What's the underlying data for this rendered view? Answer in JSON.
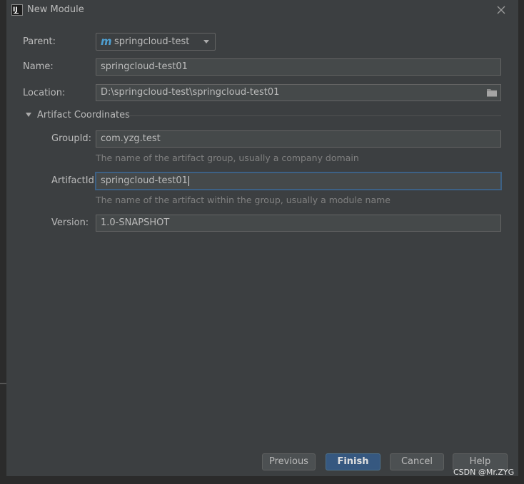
{
  "dialog": {
    "title": "New Module",
    "close_icon": "close-icon",
    "app_icon_text": "IJ"
  },
  "form": {
    "parent_label": "Parent:",
    "parent_value": "springcloud-test",
    "parent_icon": "maven-icon",
    "name_label": "Name:",
    "name_value": "springcloud-test01",
    "location_label": "Location:",
    "location_value": "D:\\springcloud-test\\springcloud-test01",
    "location_icon": "folder-icon"
  },
  "artifact": {
    "section_title": "Artifact Coordinates",
    "groupid_label": "GroupId:",
    "groupid_value": "com.yzg.test",
    "groupid_hint": "The name of the artifact group, usually a company domain",
    "artifactid_label": "ArtifactId:",
    "artifactid_value": "springcloud-test01",
    "artifactid_hint": "The name of the artifact within the group, usually a module name",
    "version_label": "Version:",
    "version_value": "1.0-SNAPSHOT"
  },
  "buttons": {
    "previous": "Previous",
    "finish": "Finish",
    "cancel": "Cancel",
    "help": "Help"
  },
  "watermark": "CSDN @Mr.ZYG",
  "colors": {
    "dialog_bg": "#3c3f41",
    "field_bg": "#45494a",
    "focus_border": "#3d6185",
    "primary_button": "#365880"
  }
}
